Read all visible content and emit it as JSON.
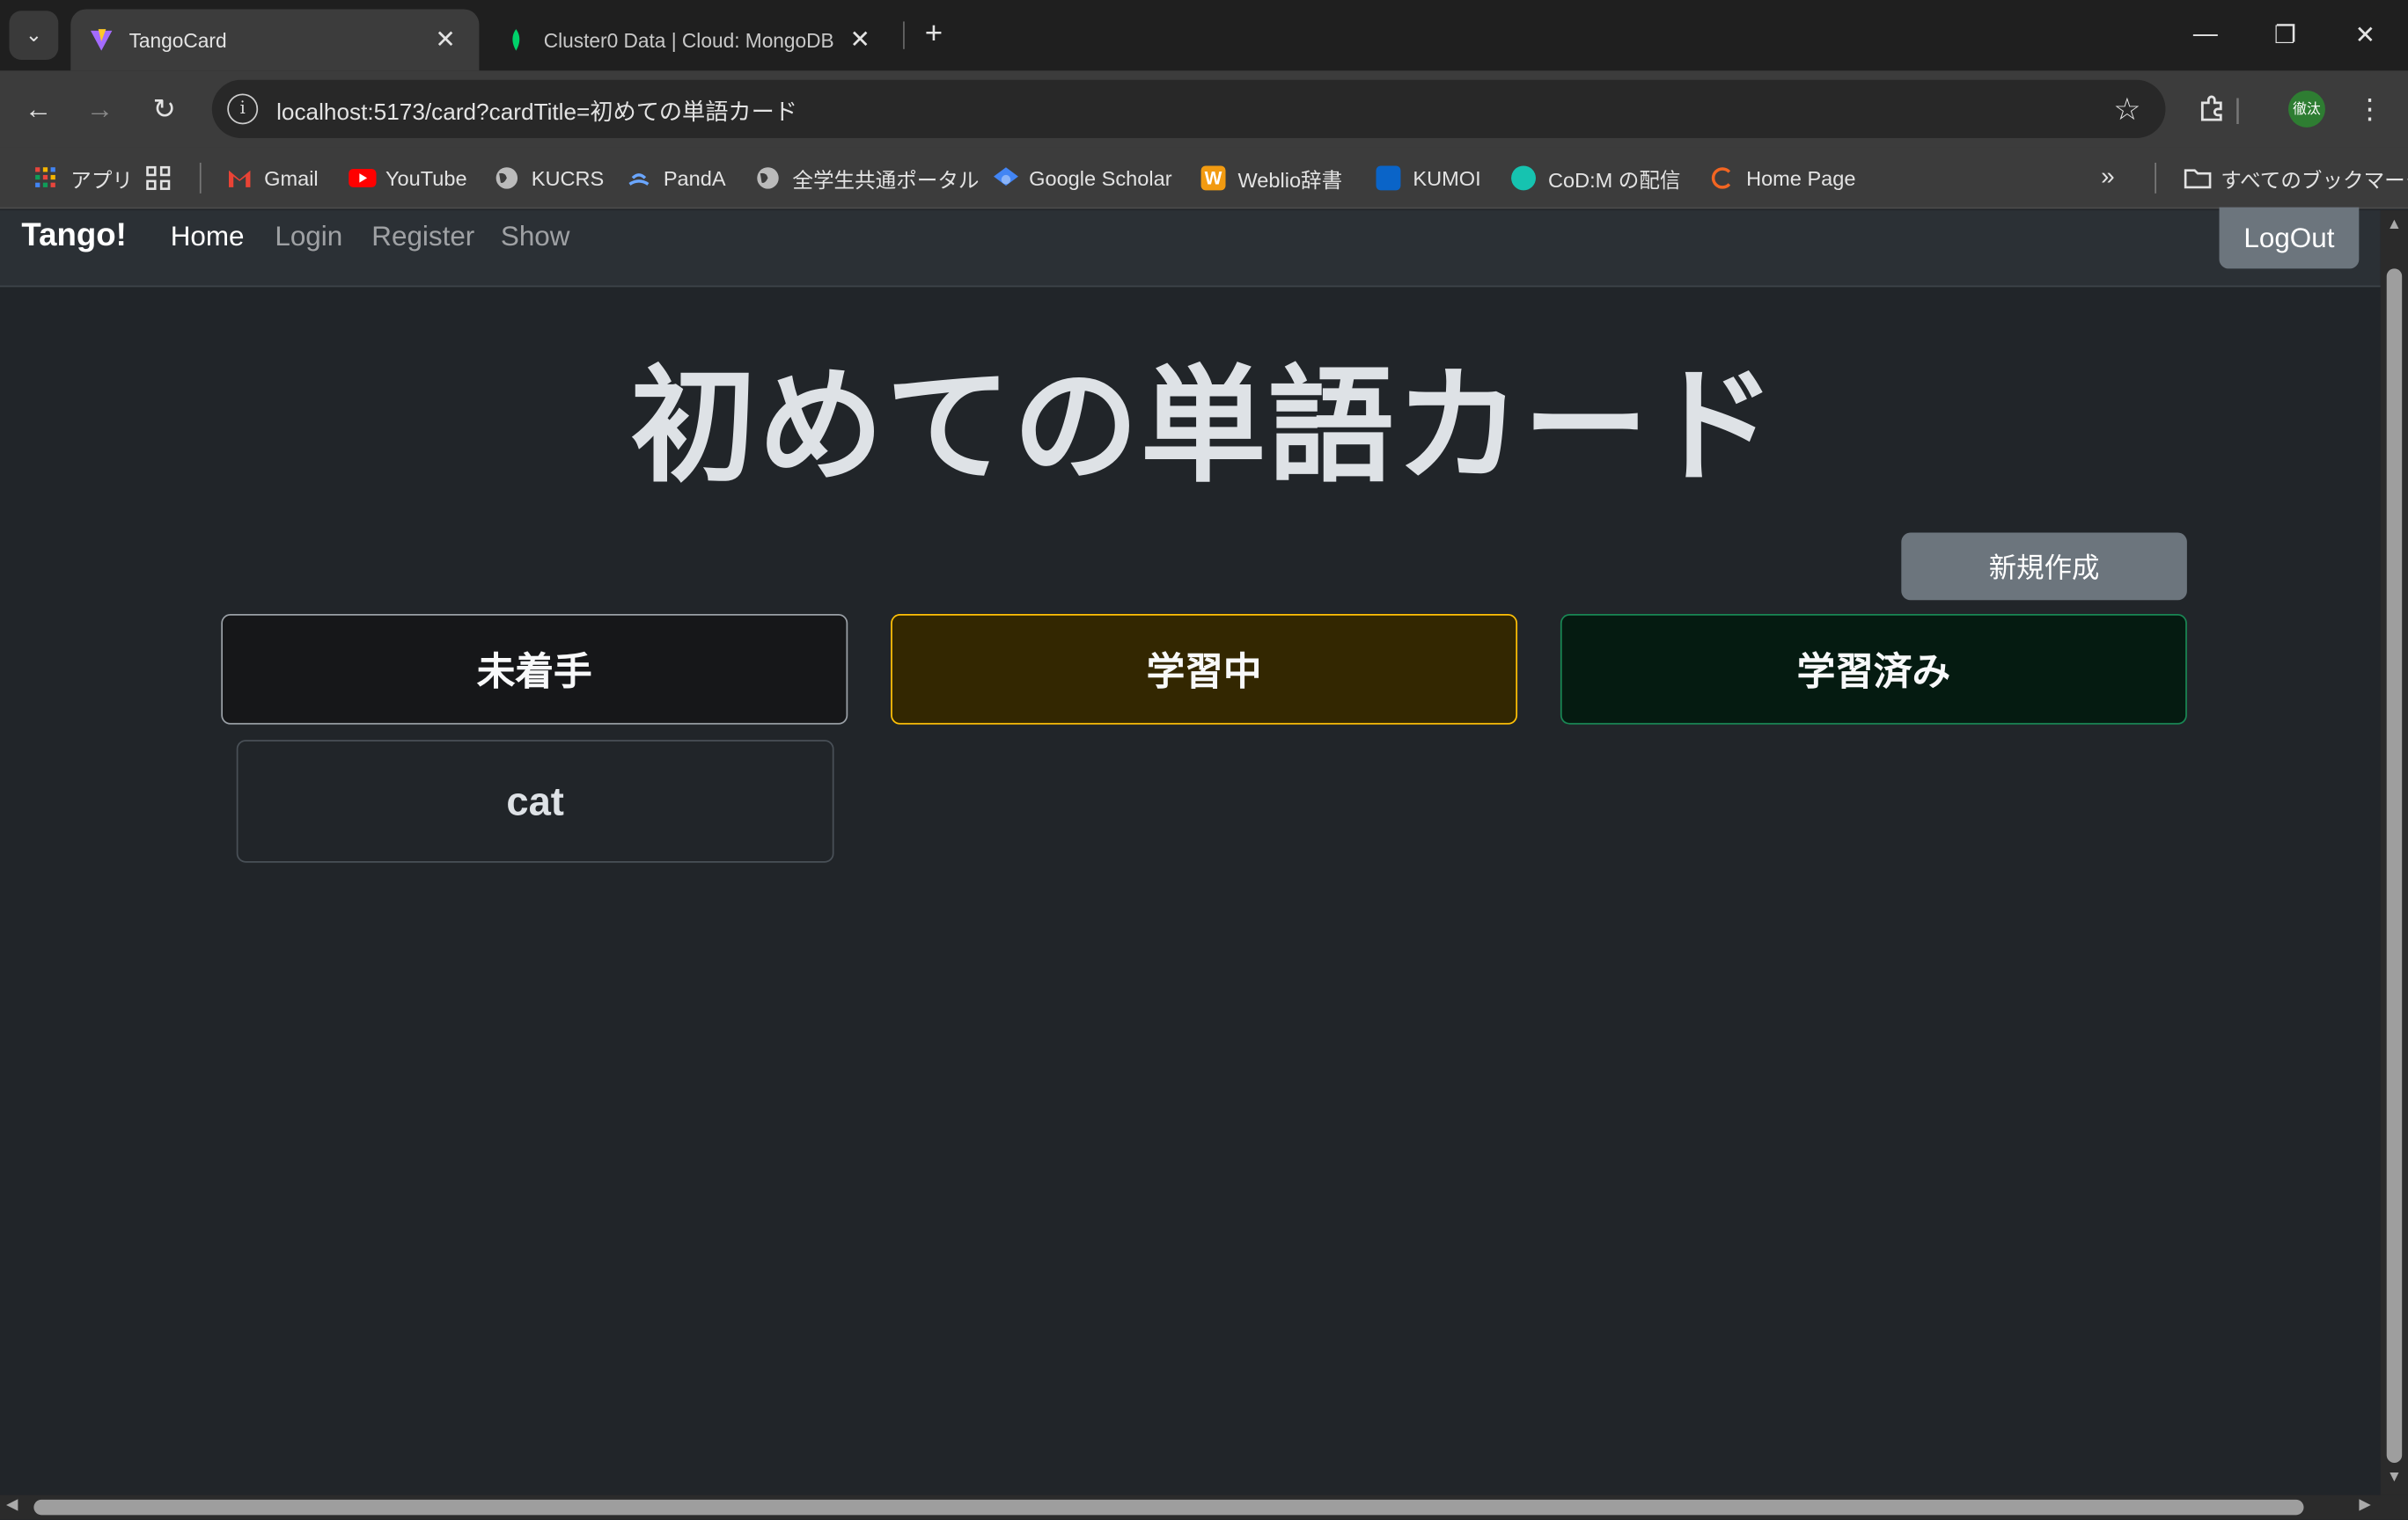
{
  "browser": {
    "tabs": [
      {
        "title": "TangoCard",
        "active": true
      },
      {
        "title": "Cluster0 Data | Cloud: MongoDB",
        "active": false
      }
    ],
    "url": "localhost:5173/card?cardTitle=初めての単語カード",
    "profile_initials": "徹汰",
    "bookmarks": [
      {
        "label": "アプリ"
      },
      {
        "label": "Gmail"
      },
      {
        "label": "YouTube"
      },
      {
        "label": "KUCRS"
      },
      {
        "label": "PandA"
      },
      {
        "label": "全学生共通ポータル"
      },
      {
        "label": "Google Scholar"
      },
      {
        "label": "Weblio辞書"
      },
      {
        "label": "KUMOI"
      },
      {
        "label": "CoD:M の配信"
      },
      {
        "label": "Home Page"
      }
    ],
    "all_bookmarks_label": "すべてのブックマーク"
  },
  "app": {
    "brand": "Tango!",
    "nav": [
      "Home",
      "Login",
      "Register",
      "Show"
    ],
    "logout_label": "LogOut",
    "title": "初めての単語カード",
    "new_button_label": "新規作成",
    "columns": [
      "未着手",
      "学習中",
      "学習済み"
    ],
    "cards": [
      {
        "word": "cat",
        "column": "未着手"
      }
    ]
  },
  "colors": {
    "todo_border": "#9aa0a6",
    "doing_border": "#ffc107",
    "done_border": "#198754",
    "button_secondary": "#6c757d"
  }
}
